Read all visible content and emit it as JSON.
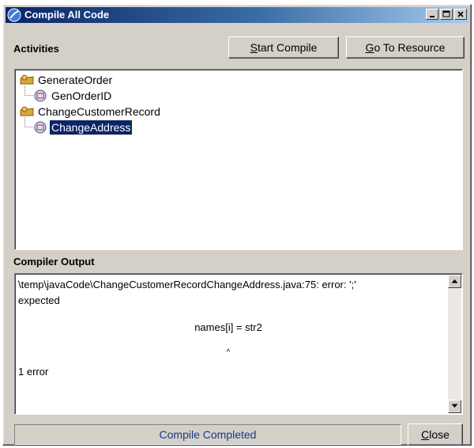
{
  "window": {
    "title": "Compile All Code",
    "icon": "app-globe-icon",
    "controls": [
      "minimize-icon",
      "maximize-icon",
      "close-icon"
    ]
  },
  "activities": {
    "label": "Activities",
    "start_compile_prefix": "S",
    "start_compile_rest": "tart Compile",
    "go_to_resource_prefix": "G",
    "go_to_resource_rest": "o To Resource",
    "tree": [
      {
        "label": "GenerateOrder",
        "icon": "activity-folder-icon",
        "level": 0,
        "selected": false
      },
      {
        "label": "GenOrderID",
        "icon": "code-resource-icon",
        "level": 1,
        "selected": false
      },
      {
        "label": "ChangeCustomerRecord",
        "icon": "activity-folder-icon",
        "level": 0,
        "selected": false
      },
      {
        "label": "ChangeAddress",
        "icon": "code-resource-icon",
        "level": 1,
        "selected": true
      }
    ]
  },
  "compiler_output": {
    "label": "Compiler Output",
    "line1": "\\temp\\javaCode\\ChangeCustomerRecordChangeAddress.java:75: error: ';'",
    "line2": "expected",
    "line3": "names[i] = str2",
    "line4": "^",
    "line5": "1 error"
  },
  "status": {
    "text": "Compile Completed",
    "close_prefix": "C",
    "close_rest": "lose"
  },
  "colors": {
    "title_bar_start": "#0a246a",
    "title_bar_end": "#a6caf0",
    "dialog_background": "#d4d0c8",
    "selection": "#0a246a",
    "status_text": "#1a3a8a"
  }
}
